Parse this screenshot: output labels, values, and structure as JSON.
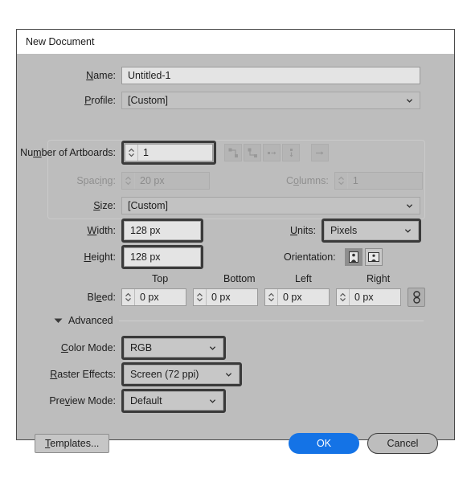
{
  "dialog": {
    "title": "New Document"
  },
  "fields": {
    "name_label": "Name:",
    "name_label_mnemonic": "N",
    "name_value": "Untitled-1",
    "profile_label": "Profile:",
    "profile_value": "[Custom]",
    "artboards_label": "Number of Artboards:",
    "artboards_value": "1",
    "spacing_label": "Spacing:",
    "spacing_value": "20 px",
    "columns_label": "Columns:",
    "columns_value": "1",
    "size_label": "Size:",
    "size_value": "[Custom]",
    "width_label": "Width:",
    "width_value": "128 px",
    "height_label": "Height:",
    "height_value": "128 px",
    "units_label": "Units:",
    "units_value": "Pixels",
    "orientation_label": "Orientation:"
  },
  "bleed": {
    "label": "Bleed:",
    "top_header": "Top",
    "bottom_header": "Bottom",
    "left_header": "Left",
    "right_header": "Right",
    "top_value": "0 px",
    "bottom_value": "0 px",
    "left_value": "0 px",
    "right_value": "0 px"
  },
  "advanced": {
    "title": "Advanced",
    "color_mode_label": "Color Mode:",
    "color_mode_value": "RGB",
    "raster_effects_label": "Raster Effects:",
    "raster_effects_value": "Screen (72 ppi)",
    "preview_mode_label": "Preview Mode:",
    "preview_mode_value": "Default"
  },
  "footer": {
    "templates_label": "Templates...",
    "ok_label": "OK",
    "cancel_label": "Cancel"
  },
  "colors": {
    "accent": "#1473e6",
    "dialog_bg": "#bdbdbd",
    "field_bg": "#e4e4e4",
    "focus_ring": "#3a3a3a"
  }
}
